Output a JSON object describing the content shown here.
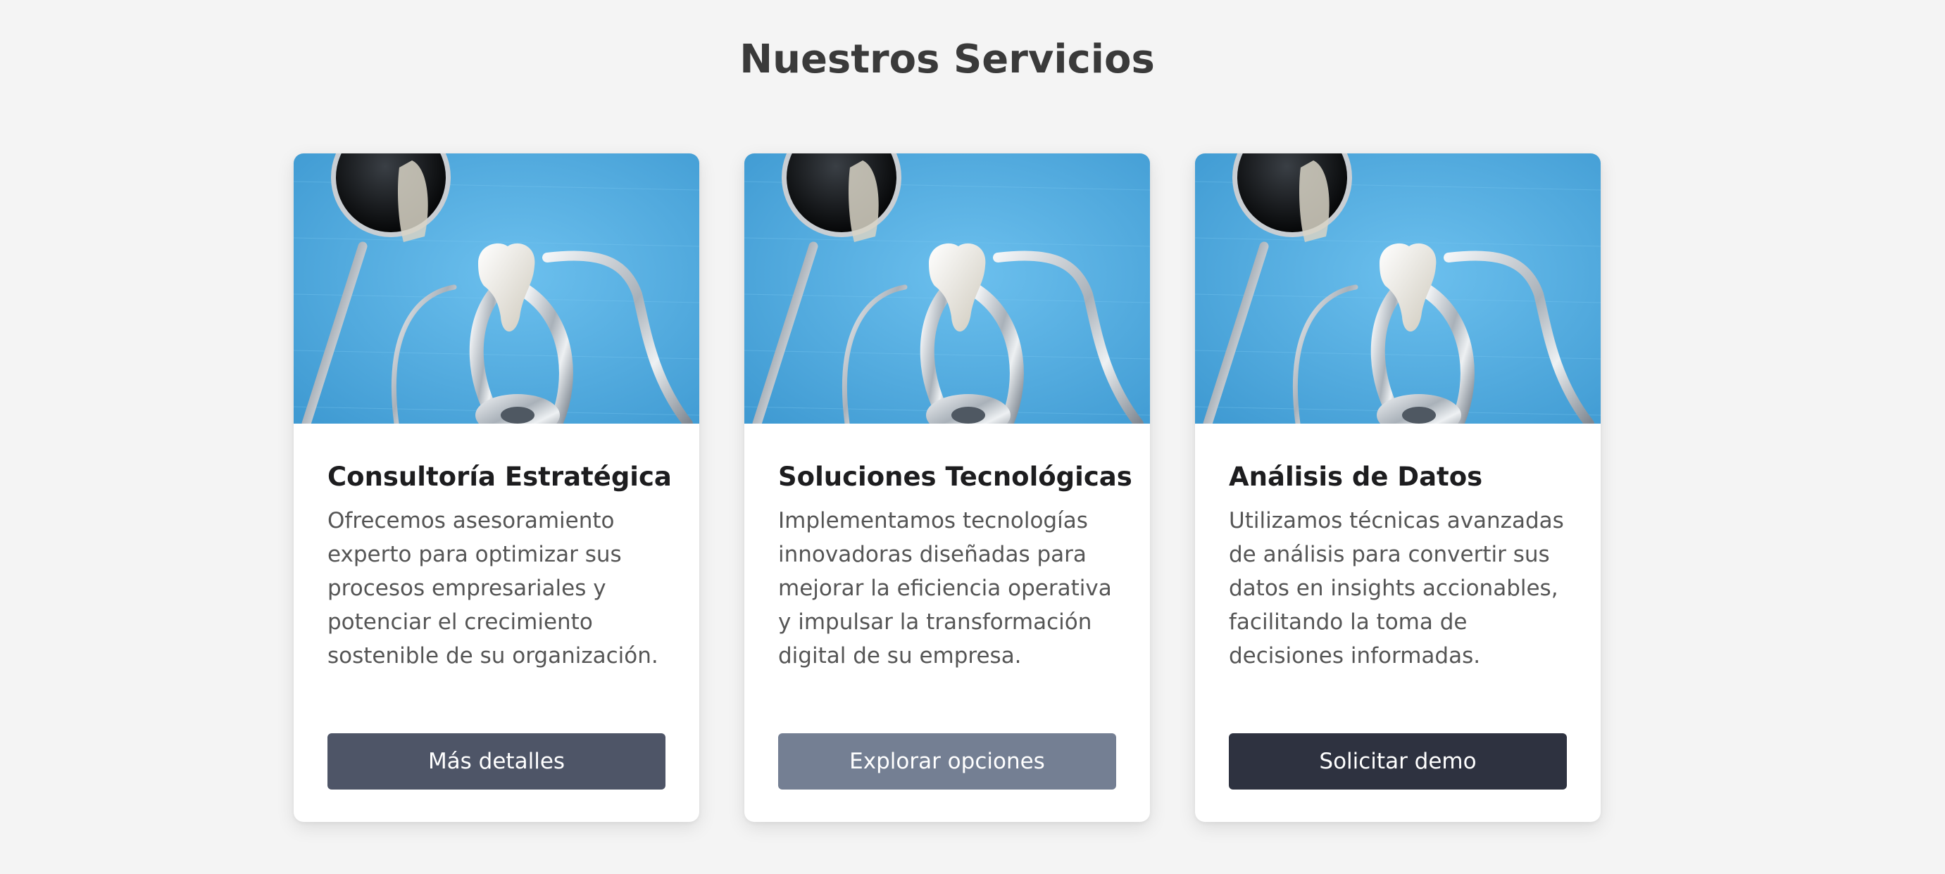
{
  "section": {
    "title": "Nuestros Servicios"
  },
  "cards": [
    {
      "image_icon": "dental-tools-image",
      "title": "Consultoría Estratégica",
      "description": "Ofrecemos asesoramiento experto para optimizar sus procesos empresariales y potenciar el crecimiento sostenible de su organización.",
      "button_label": "Más detalles",
      "button_color": "#4e5567"
    },
    {
      "image_icon": "dental-tools-image",
      "title": "Soluciones Tecnológicas",
      "description": "Implementamos tecnologías innovadoras diseñadas para mejorar la eficiencia operativa y impulsar la transformación digital de su empresa.",
      "button_label": "Explorar opciones",
      "button_color": "#747f93"
    },
    {
      "image_icon": "dental-tools-image",
      "title": "Análisis de Datos",
      "description": "Utilizamos técnicas avanzadas de análisis para convertir sus datos en insights accionables, facilitando la toma de decisiones informadas.",
      "button_label": "Solicitar demo",
      "button_color": "#2e3240"
    }
  ],
  "colors": {
    "page_background": "#f4f4f4",
    "card_background": "#ffffff",
    "image_background": "#5cb0e2"
  }
}
